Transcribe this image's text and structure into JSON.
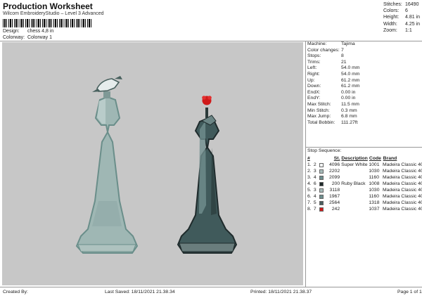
{
  "header": {
    "title": "Production Worksheet",
    "subtitle": "Wilcom EmbroideryStudio – Level 3 Advanced",
    "design_label": "Design:",
    "design_value": "chess 4,8 in",
    "colorway_label": "Colorway:",
    "colorway_value": "Colorway 1"
  },
  "stats": [
    {
      "label": "Stitches:",
      "value": "16490"
    },
    {
      "label": "Colors:",
      "value": "6"
    },
    {
      "label": "Height:",
      "value": "4.81 in"
    },
    {
      "label": "Width:",
      "value": "4.25 in"
    },
    {
      "label": "Zoom:",
      "value": "1:1"
    }
  ],
  "machine": [
    {
      "label": "Machine:",
      "value": "Tajima"
    },
    {
      "label": "Color changes:",
      "value": "7"
    },
    {
      "label": "Stops:",
      "value": "8"
    },
    {
      "label": "Trims:",
      "value": "21"
    },
    {
      "label": "Left:",
      "value": "54.0 mm"
    },
    {
      "label": "Right:",
      "value": "54.0 mm"
    },
    {
      "label": "Up:",
      "value": "61.2 mm"
    },
    {
      "label": "Down:",
      "value": "61.2 mm"
    },
    {
      "label": "EndX:",
      "value": "0.00 in"
    },
    {
      "label": "EndY:",
      "value": "0.00 in"
    },
    {
      "label": "Max Stitch:",
      "value": "11.5 mm"
    },
    {
      "label": "Min Stitch:",
      "value": "0.3 mm"
    },
    {
      "label": "Max Jump:",
      "value": "6.8 mm"
    },
    {
      "label": "Total Bobbin:",
      "value": "111.27ft"
    }
  ],
  "stop_sequence": {
    "title": "Stop Sequence:",
    "headers": {
      "n": "#",
      "st": "St.",
      "desc": "Description",
      "code": "Code",
      "brand": "Brand"
    },
    "rows": [
      {
        "sn": "1.",
        "cn": "2",
        "color": "#f4f6f6",
        "st": "4096",
        "desc": "Super White",
        "code": "1001",
        "brand": "Madeira Classic 40"
      },
      {
        "sn": "2.",
        "cn": "3",
        "color": "#a7bcbb",
        "st": "2202",
        "desc": "",
        "code": "1030",
        "brand": "Madeira Classic 40"
      },
      {
        "sn": "3.",
        "cn": "4",
        "color": "#6e8f8e",
        "st": "2099",
        "desc": "",
        "code": "1160",
        "brand": "Madeira Classic 40"
      },
      {
        "sn": "4.",
        "cn": "6",
        "color": "#1f2a2b",
        "st": "200",
        "desc": "Ruby Black",
        "code": "1008",
        "brand": "Madeira Classic 40"
      },
      {
        "sn": "5.",
        "cn": "3",
        "color": "#a7bcbb",
        "st": "3118",
        "desc": "",
        "code": "1030",
        "brand": "Madeira Classic 40"
      },
      {
        "sn": "6.",
        "cn": "4",
        "color": "#6e8f8e",
        "st": "1967",
        "desc": "",
        "code": "1160",
        "brand": "Madeira Classic 40"
      },
      {
        "sn": "7.",
        "cn": "5",
        "color": "#4a5f60",
        "st": "2564",
        "desc": "",
        "code": "1318",
        "brand": "Madeira Classic 40"
      },
      {
        "sn": "8.",
        "cn": "7",
        "color": "#d01a1a",
        "st": "242",
        "desc": "",
        "code": "1037",
        "brand": "Madeira Classic 40"
      }
    ]
  },
  "footer": {
    "created": "Created By:",
    "saved": "Last Saved: 18/11/2021 21.38.34",
    "printed": "Printed: 18/11/2021 21.38.37",
    "page": "Page 1 of 1"
  },
  "canvas": {
    "background": "#c7c7c7",
    "left_piece": "chess piece with bird (light teal)",
    "right_piece": "chess piece with red flower (dark teal)"
  }
}
